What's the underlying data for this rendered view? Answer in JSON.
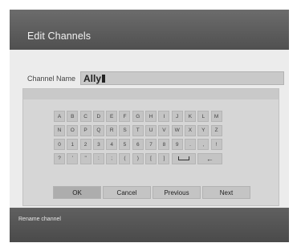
{
  "title": "Edit Channels",
  "channel_name": {
    "label": "Channel Name",
    "value": "Ally"
  },
  "keyboard": {
    "rows": [
      [
        "A",
        "B",
        "C",
        "D",
        "E",
        "F",
        "G",
        "H",
        "I",
        "J",
        "K",
        "L",
        "M"
      ],
      [
        "N",
        "O",
        "P",
        "Q",
        "R",
        "S",
        "T",
        "U",
        "V",
        "W",
        "X",
        "Y",
        "Z"
      ],
      [
        "0",
        "1",
        "2",
        "3",
        "4",
        "5",
        "6",
        "7",
        "8",
        "9",
        ".",
        ",",
        "!"
      ],
      [
        "?",
        "'",
        "\"",
        ":",
        ";",
        "(",
        ")",
        "[",
        "]",
        "space",
        "backspace"
      ]
    ],
    "icons": {
      "space": "space-bar-icon",
      "backspace": "left-arrow-icon"
    }
  },
  "buttons": {
    "ok": "OK",
    "cancel": "Cancel",
    "previous": "Previous",
    "next": "Next"
  },
  "status": "Rename channel",
  "colors": {
    "title_bar": "#5a5a5a",
    "footer": "#545454",
    "body": "#ececec",
    "key": "#c4c4c4"
  }
}
